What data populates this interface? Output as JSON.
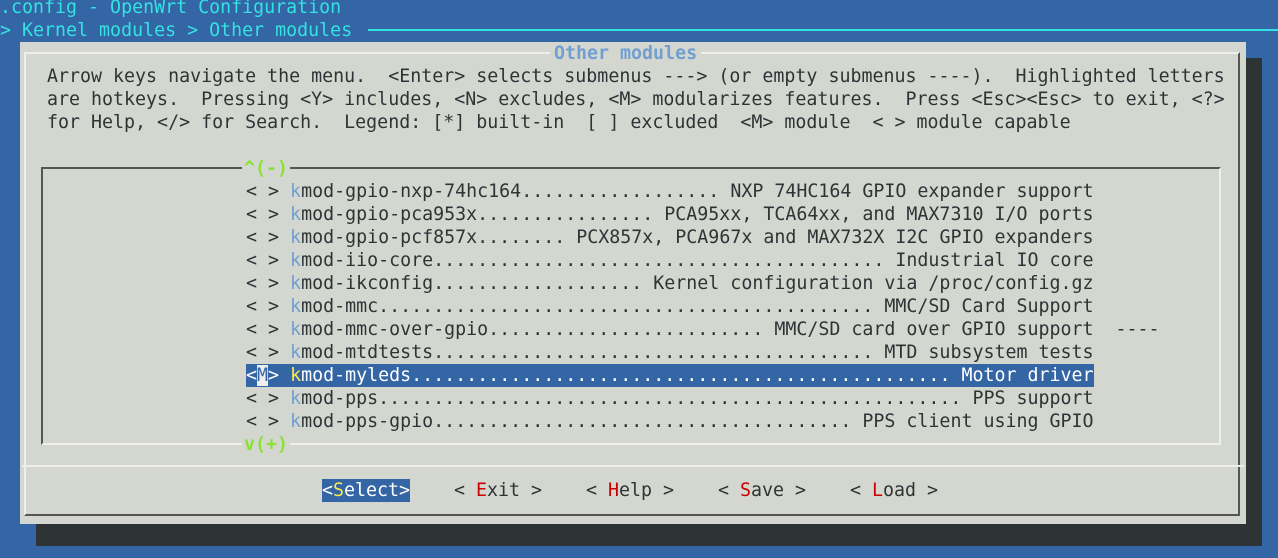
{
  "header": {
    "title": ".config - OpenWrt Configuration",
    "breadcrumb": "> Kernel modules > Other modules"
  },
  "dialog": {
    "title": "Other modules",
    "help_lines": [
      "Arrow keys navigate the menu.  <Enter> selects submenus ---> (or empty submenus ----).  Highlighted letters",
      "are hotkeys.  Pressing <Y> includes, <N> excludes, <M> modularizes features.  Press <Esc><Esc> to exit, <?>",
      "for Help, </> for Search.  Legend: [*] built-in  [ ] excluded  <M> module  < > module capable"
    ],
    "scroll_up": "^(-)",
    "scroll_down": "v(+)"
  },
  "items": [
    {
      "state": "< >",
      "name": "kmod-gpio-nxp-74hc164",
      "desc": "NXP 74HC164 GPIO expander support",
      "suffix": ""
    },
    {
      "state": "< >",
      "name": "kmod-gpio-pca953x",
      "desc": "PCA95xx, TCA64xx, and MAX7310 I/O ports",
      "suffix": ""
    },
    {
      "state": "< >",
      "name": "kmod-gpio-pcf857x",
      "desc": "PCX857x, PCA967x and MAX732X I2C GPIO expanders",
      "suffix": ""
    },
    {
      "state": "< >",
      "name": "kmod-iio-core",
      "desc": "Industrial IO core",
      "suffix": ""
    },
    {
      "state": "< >",
      "name": "kmod-ikconfig",
      "desc": "Kernel configuration via /proc/config.gz",
      "suffix": ""
    },
    {
      "state": "< >",
      "name": "kmod-mmc",
      "desc": "MMC/SD Card Support",
      "suffix": ""
    },
    {
      "state": "< >",
      "name": "kmod-mmc-over-gpio",
      "desc": "MMC/SD card over GPIO support",
      "suffix": "  ----"
    },
    {
      "state": "< >",
      "name": "kmod-mtdtests",
      "desc": "MTD subsystem tests",
      "suffix": ""
    },
    {
      "state": "<M>",
      "name": "kmod-myleds",
      "desc": "Motor driver",
      "suffix": "",
      "selected": true
    },
    {
      "state": "< >",
      "name": "kmod-pps",
      "desc": "PPS support",
      "suffix": ""
    },
    {
      "state": "< >",
      "name": "kmod-pps-gpio",
      "desc": "PPS client using GPIO",
      "suffix": ""
    }
  ],
  "buttons": [
    {
      "label": "<Select>",
      "hotkey": "S",
      "selected": true
    },
    {
      "label": "< Exit >",
      "hotkey": "E"
    },
    {
      "label": "< Help >",
      "hotkey": "H"
    },
    {
      "label": "< Save >",
      "hotkey": "S"
    },
    {
      "label": "< Load >",
      "hotkey": "L"
    }
  ],
  "colors": {
    "background": "#3465a4",
    "dialog": "#d3d7cf",
    "header_text": "#34e2e2",
    "hotkey_item": "#729fcf",
    "hotkey_button": "#cc0000",
    "hotkey_selected": "#fce94f",
    "scroll_arrow": "#8ae234"
  }
}
